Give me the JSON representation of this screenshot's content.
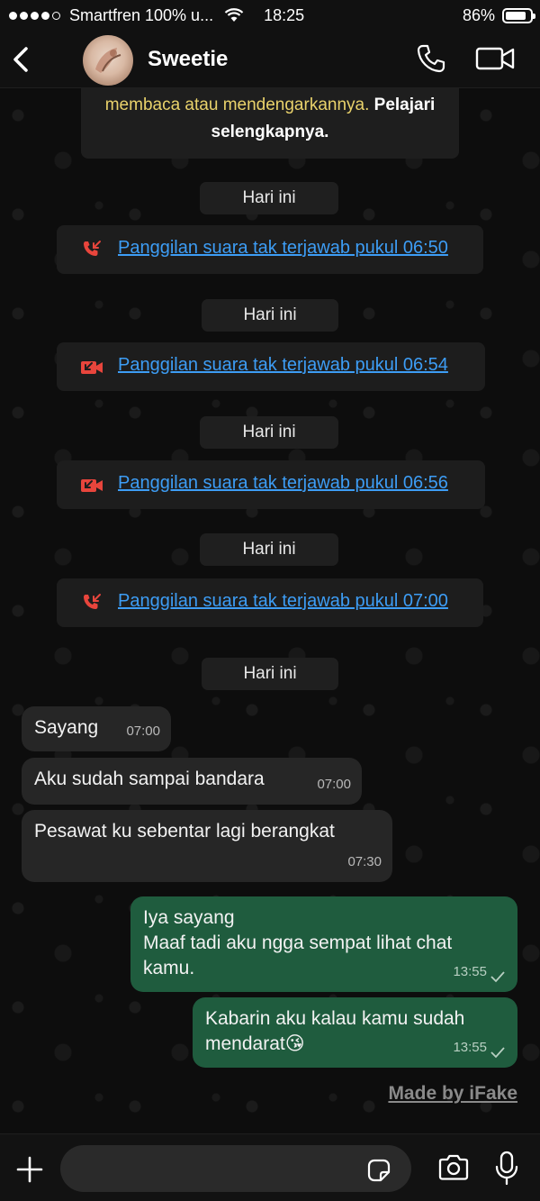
{
  "status_bar": {
    "carrier": "Smartfren 100% u...",
    "time": "18:25",
    "battery_pct": "86%",
    "battery_level": 0.86
  },
  "header": {
    "contact_name": "Sweetie",
    "back_icon": "chevron-left-icon",
    "call_icon": "phone-icon",
    "video_icon": "video-camera-icon"
  },
  "info_banner": {
    "text_yellow": "membaca atau mendengarkannya.",
    "text_bold_1": "Pelajari",
    "text_bold_2": "selengkapnya."
  },
  "timeline": {
    "date_label": "Hari ini",
    "calls": [
      {
        "icon": "missed-voice-call-icon",
        "text": "Panggilan suara tak terjawab pukul 06:50"
      },
      {
        "icon": "missed-video-call-icon",
        "text": "Panggilan suara tak terjawab pukul 06:54"
      },
      {
        "icon": "missed-video-call-icon",
        "text": "Panggilan suara tak terjawab pukul 06:56"
      },
      {
        "icon": "missed-voice-call-icon",
        "text": "Panggilan suara tak terjawab pukul 07:00"
      }
    ]
  },
  "messages": [
    {
      "direction": "in",
      "text": "Sayang",
      "time": "07:00"
    },
    {
      "direction": "in",
      "text": "Aku sudah sampai bandara",
      "time": "07:00"
    },
    {
      "direction": "in",
      "text": "Pesawat ku sebentar lagi berangkat",
      "time": "07:30"
    },
    {
      "direction": "out",
      "text": "Iya sayang\nMaaf tadi aku ngga sempat lihat chat\nkamu.",
      "time": "13:55",
      "status": "sent-check-icon"
    },
    {
      "direction": "out",
      "text": "Kabarin aku kalau kamu sudah\nmendarat😘",
      "time": "13:55",
      "status": "sent-check-icon"
    }
  ],
  "watermark": "Made by iFake",
  "input_bar": {
    "placeholder": "",
    "plus_icon": "plus-icon",
    "sticker_icon": "sticker-icon",
    "camera_icon": "camera-icon",
    "mic_icon": "microphone-icon"
  },
  "colors": {
    "link_blue": "#3d9df5",
    "missed_red": "#e8453c",
    "outgoing_bubble": "#1f5c3e",
    "incoming_bubble": "#262626",
    "banner_yellow": "#e9d26b"
  }
}
